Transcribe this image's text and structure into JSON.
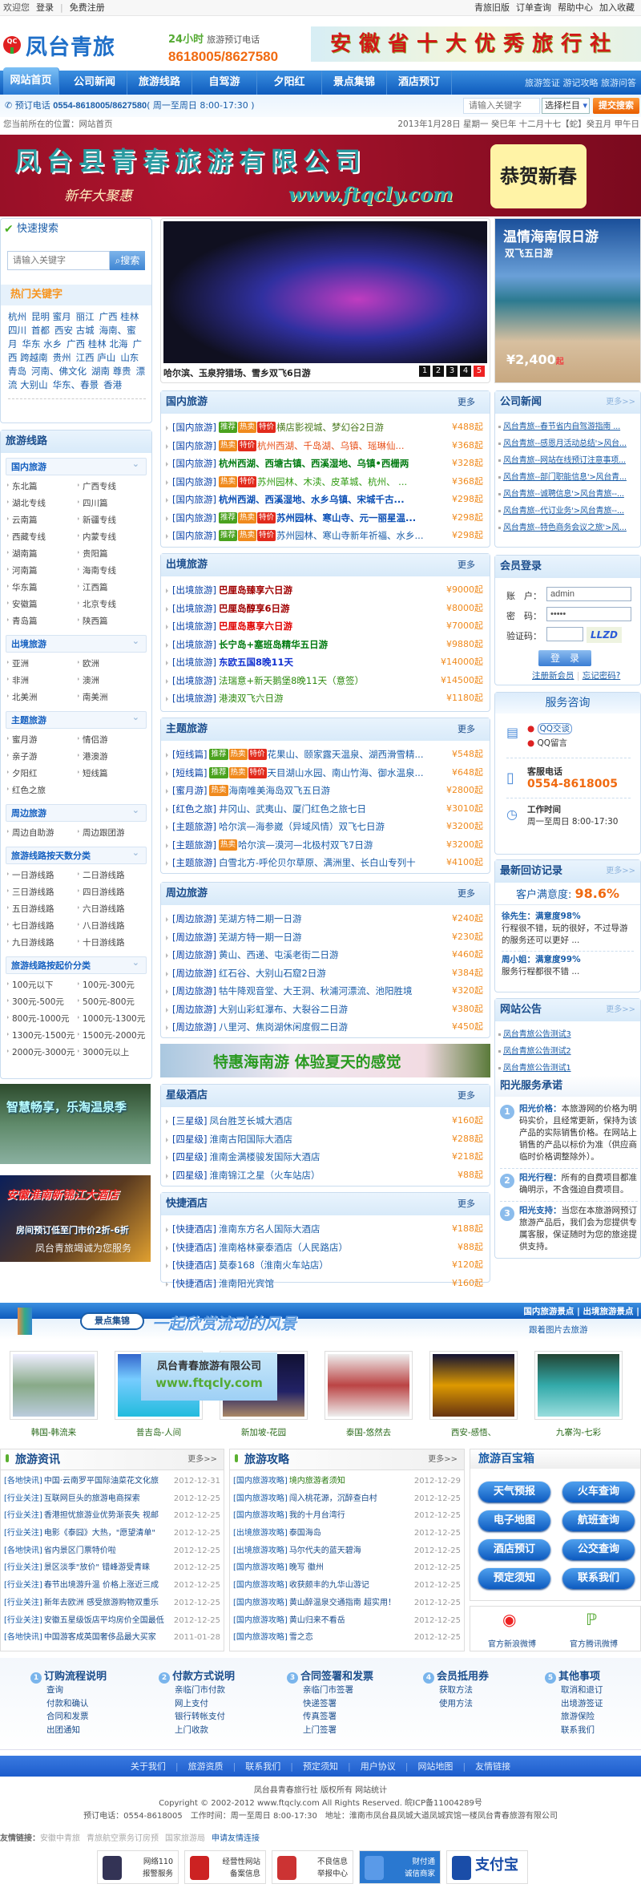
{
  "topbar": {
    "welcome": "欢迎您",
    "login": "登录",
    "register": "免费注册",
    "links": [
      "青旅旧版",
      "订单查询",
      "帮助中心",
      "加入收藏"
    ]
  },
  "header": {
    "logo_text": "凤台青旅",
    "logo_badge": "QC",
    "hotline_24": "24小时",
    "hotline_label": "旅游预订电话",
    "hotline": "8618005/8627580",
    "banner": "安徽省十大优秀旅行社"
  },
  "nav": {
    "items": [
      "网站首页",
      "公司新闻",
      "旅游线路",
      "自驾游",
      "夕阳红",
      "景点集锦",
      "酒店预订"
    ],
    "extra": [
      "旅游签证",
      "游记攻略",
      "旅游问答"
    ]
  },
  "subbar": {
    "phone_label": "预订电话",
    "phone": "0554-8618005/8627580",
    "hours": "( 周一至周日 8:00-17:30 )",
    "search_placeholder": "请输入关键字",
    "select_value": "选择栏目",
    "search_button": "提交搜索"
  },
  "breadcrumb": {
    "label": "您当前所在的位置：",
    "current": "网站首页",
    "date": "2013年1月28日 星期一 癸巳年 十二月十七【蛇】癸丑月 甲午日"
  },
  "main_banner": {
    "company": "凤台县青春旅游有限公司",
    "promo": "新年大聚惠",
    "url": "www.ftqcly.com",
    "greeting": "恭贺新春"
  },
  "quick_search": {
    "title": "快速搜索",
    "placeholder": "请输入关键字",
    "button": "搜索",
    "hot_title": "热门关键字",
    "keywords": [
      "杭州",
      "昆明 蜜月",
      "丽江",
      "广西 桂林",
      "四川",
      "首都",
      "西安 古城",
      "海南、蜜月",
      "华东 水乡",
      "广西 桂林 北海",
      "广西 跨越南",
      "贵州",
      "江西 庐山",
      "山东 青岛",
      "河南、佛文化",
      "湖南 尊贵",
      "漂流 大别山",
      "华东、春景",
      "香港"
    ]
  },
  "routes": {
    "title": "旅游线路",
    "groups": [
      {
        "name": "国内旅游",
        "items": [
          "东北篇",
          "广西专线",
          "湖北专线",
          "四川篇",
          "云南篇",
          "新疆专线",
          "西藏专线",
          "内蒙专线",
          "湖南篇",
          "贵阳篇",
          "河南篇",
          "海南专线",
          "华东篇",
          "江西篇",
          "安徽篇",
          "北京专线",
          "青岛篇",
          "陕西篇"
        ]
      },
      {
        "name": "出境旅游",
        "items": [
          "亚洲",
          "欧洲",
          "非洲",
          "澳洲",
          "北美洲",
          "南美洲"
        ]
      },
      {
        "name": "主题旅游",
        "items": [
          "蜜月游",
          "情侣游",
          "亲子游",
          "港澳游",
          "夕阳红",
          "短线篇",
          "红色之旅"
        ]
      },
      {
        "name": "周边旅游",
        "items": [
          "周边自助游",
          "周边跟团游"
        ]
      },
      {
        "name": "旅游线路按天数分类",
        "items": [
          "一日游线路",
          "二日游线路",
          "三日游线路",
          "四日游线路",
          "五日游线路",
          "六日游线路",
          "七日游线路",
          "八日游线路",
          "九日游线路",
          "十日游线路"
        ]
      },
      {
        "name": "旅游线路按起价分类",
        "items": [
          "100元以下",
          "100元-300元",
          "300元-500元",
          "500元-800元",
          "800元-1000元",
          "1000元-1300元",
          "1300元-1500元",
          "1500元-2000元",
          "2000元-3000元",
          "3000元以上"
        ]
      }
    ]
  },
  "left_ads": [
    {
      "text": "智慧畅享，乐淘温泉季"
    },
    {
      "text": "安徽淮南新锦江大酒店",
      "sub": "房间预订低至门市价2折-6折",
      "foot": "凤台青旅竭诚为您服务"
    }
  ],
  "slideshow": {
    "caption": "哈尔滨、玉泉狩猎场、雪乡双飞6日游",
    "pages": [
      "1",
      "2",
      "3",
      "4",
      "5"
    ],
    "active": "5"
  },
  "promo": {
    "title": "温情海南假日游",
    "sub": "双飞五日游",
    "price": "¥2,400",
    "price_suffix": "起"
  },
  "tags": [
    "推荐",
    "热卖",
    "特价"
  ],
  "sections": [
    {
      "title": "国内旅游",
      "more": "更多",
      "rows": [
        {
          "cat": "[国内旅游]",
          "tags": [
            0,
            1,
            2
          ],
          "title": "横店影视城、梦幻谷2日游",
          "color": "#4a7a1e",
          "bold": false,
          "price": "¥488起"
        },
        {
          "cat": "[国内旅游]",
          "tags": [
            1,
            2
          ],
          "title": "杭州西湖、千岛湖、乌镇、瑶琳仙...",
          "color": "#e8501a",
          "bold": false,
          "price": "¥368起"
        },
        {
          "cat": "[国内旅游]",
          "tags": [],
          "title": "杭州西湖、西塘古镇、西溪湿地、乌镇•西栅两",
          "color": "#007a10",
          "bold": true,
          "price": "¥328起"
        },
        {
          "cat": "[国内旅游]",
          "tags": [
            1,
            2
          ],
          "title": "苏州园林、木渎、皮革城、杭州、 ...",
          "color": "#2f9a10",
          "bold": false,
          "price": "¥368起"
        },
        {
          "cat": "[国内旅游]",
          "tags": [],
          "title": "杭州西湖、西溪湿地、水乡乌镇、宋城千古...",
          "color": "#0b4fb5",
          "bold": true,
          "price": "¥298起"
        },
        {
          "cat": "[国内旅游]",
          "tags": [
            0,
            1,
            2
          ],
          "title": "苏州园林、寒山寺、元一丽星温...",
          "color": "#0b4fb5",
          "bold": true,
          "price": "¥298起"
        },
        {
          "cat": "[国内旅游]",
          "tags": [
            0,
            1,
            2
          ],
          "title": "苏州园林、寒山寺新年祈福、水乡...",
          "color": "#1a5da8",
          "bold": false,
          "price": "¥298起"
        }
      ]
    },
    {
      "title": "出境旅游",
      "more": "更多",
      "rows": [
        {
          "cat": "[出境旅游]",
          "tags": [],
          "title": "巴厘岛臻享六日游",
          "color": "#a00000",
          "bold": true,
          "price": "¥9000起"
        },
        {
          "cat": "[出境旅游]",
          "tags": [],
          "title": "巴厘岛醇享6日游",
          "color": "#a00000",
          "bold": true,
          "price": "¥8000起"
        },
        {
          "cat": "[出境旅游]",
          "tags": [],
          "title": "巴厘岛惠享六日游",
          "color": "#e00000",
          "bold": true,
          "price": "¥7000起"
        },
        {
          "cat": "[出境旅游]",
          "tags": [],
          "title": "长宁岛+塞班岛精华五日游",
          "color": "#007a10",
          "bold": true,
          "price": "¥9880起"
        },
        {
          "cat": "[出境旅游]",
          "tags": [],
          "title": "东欧五国8晚11天",
          "color": "#1030d0",
          "bold": true,
          "price": "¥14000起"
        },
        {
          "cat": "[出境旅游]",
          "tags": [],
          "title": "法瑞意+新天鹅堡8晚11天（意签）",
          "color": "#2f8a10",
          "bold": false,
          "price": "¥14500起"
        },
        {
          "cat": "[出境旅游]",
          "tags": [],
          "title": "港澳双飞六日游",
          "color": "#2f8a10",
          "bold": false,
          "price": "¥1180起"
        }
      ]
    },
    {
      "title": "主题旅游",
      "more": "更多",
      "rows": [
        {
          "cat": "[短线篇]",
          "tags": [
            0,
            1,
            2
          ],
          "title": "花果山、颐家露天温泉、湖西滑雪精...",
          "color": "#1a5da8",
          "bold": false,
          "price": "¥548起"
        },
        {
          "cat": "[短线篇]",
          "tags": [
            0,
            1,
            2
          ],
          "title": "天目湖山水园、南山竹海、御水温泉...",
          "color": "#1a5da8",
          "bold": false,
          "price": "¥648起"
        },
        {
          "cat": "[蜜月游]",
          "tags": [
            1
          ],
          "title": "海南唯美海岛双飞五日游",
          "color": "#1a5da8",
          "bold": false,
          "price": "¥2800起"
        },
        {
          "cat": "[红色之旅]",
          "tags": [],
          "title": "井冈山、武夷山、厦门红色之旅七日",
          "color": "#1a5da8",
          "bold": false,
          "price": "¥3010起"
        },
        {
          "cat": "[主题旅游]",
          "tags": [],
          "title": "哈尔滨—海参崴（异域风情）双飞七日游",
          "color": "#1a5da8",
          "bold": false,
          "price": "¥3200起"
        },
        {
          "cat": "[主题旅游]",
          "tags": [
            1
          ],
          "title": "哈尔滨—漠河—北极村双飞7日游",
          "color": "#1a5da8",
          "bold": false,
          "price": "¥3200起"
        },
        {
          "cat": "[主题旅游]",
          "tags": [],
          "title": "白雪北方-呼伦贝尔草原、满洲里、长白山专列十",
          "color": "#1a5da8",
          "bold": false,
          "price": "¥4100起"
        }
      ]
    },
    {
      "title": "周边旅游",
      "more": "更多",
      "rows": [
        {
          "cat": "[周边旅游]",
          "tags": [],
          "title": "芜湖方特二期一日游",
          "color": "#1a5da8",
          "bold": false,
          "price": "¥240起"
        },
        {
          "cat": "[周边旅游]",
          "tags": [],
          "title": "芜湖方特一期一日游",
          "color": "#1a5da8",
          "bold": false,
          "price": "¥230起"
        },
        {
          "cat": "[周边旅游]",
          "tags": [],
          "title": "黄山、西递、屯溪老街二日游",
          "color": "#1a5da8",
          "bold": false,
          "price": "¥460起"
        },
        {
          "cat": "[周边旅游]",
          "tags": [],
          "title": "红石谷、大别山石窟2日游",
          "color": "#1a5da8",
          "bold": false,
          "price": "¥384起"
        },
        {
          "cat": "[周边旅游]",
          "tags": [],
          "title": "牯牛降观音堂、大王洞、秋浦河漂流、池阳胜境",
          "color": "#1a5da8",
          "bold": false,
          "price": "¥320起"
        },
        {
          "cat": "[周边旅游]",
          "tags": [],
          "title": "大别山彩虹瀑布、大裂谷二日游",
          "color": "#1a5da8",
          "bold": false,
          "price": "¥380起"
        },
        {
          "cat": "[周边旅游]",
          "tags": [],
          "title": "八里河、焦岗湖休闲度假二日游",
          "color": "#1a5da8",
          "bold": false,
          "price": "¥450起"
        }
      ]
    },
    {
      "title": "星级酒店",
      "more": "更多",
      "rows": [
        {
          "cat": "[三星级]",
          "tags": [],
          "title": "凤台胜芝长城大酒店",
          "color": "#1a5da8",
          "bold": false,
          "price": "¥160起"
        },
        {
          "cat": "[四星级]",
          "tags": [],
          "title": "淮南古阳国际大酒店",
          "color": "#1a5da8",
          "bold": false,
          "price": "¥288起"
        },
        {
          "cat": "[四星级]",
          "tags": [],
          "title": "淮南金满楼骏发国际大酒店",
          "color": "#1a5da8",
          "bold": false,
          "price": "¥218起"
        },
        {
          "cat": "[四星级]",
          "tags": [],
          "title": "淮南锦江之星（火车站店）",
          "color": "#1a5da8",
          "bold": false,
          "price": "¥88起"
        }
      ]
    },
    {
      "title": "快捷酒店",
      "more": "更多",
      "rows": [
        {
          "cat": "[快捷酒店]",
          "tags": [],
          "title": "淮南东方名人国际大酒店",
          "color": "#1a5da8",
          "bold": false,
          "price": "¥188起"
        },
        {
          "cat": "[快捷酒店]",
          "tags": [],
          "title": "淮南格林豪泰酒店（人民路店）",
          "color": "#1a5da8",
          "bold": false,
          "price": "¥88起"
        },
        {
          "cat": "[快捷酒店]",
          "tags": [],
          "title": "莫泰168（淮南火车站店）",
          "color": "#1a5da8",
          "bold": false,
          "price": "¥120起"
        },
        {
          "cat": "[快捷酒店]",
          "tags": [],
          "title": "淮南阳光宾馆",
          "color": "#1a5da8",
          "bold": false,
          "price": "¥160起"
        }
      ]
    }
  ],
  "hainan_banner": "特惠海南游 体验夏天的感觉",
  "company_news": {
    "title": "公司新闻",
    "more": "更多>>",
    "items": [
      "风台青旅--春节省内自驾游指南 ...",
      "风台青旅--感恩月活动总结'>风台...",
      "风台青旅--网站在线预订注意事项...",
      "风台青旅--部门职能信息'>风台青...",
      "风台青旅--诚聘信息'>风台青旅--...",
      "风台青旅--代订业务'>风台青旅--...",
      "风台青旅--特色商务会议之旅'>风..."
    ]
  },
  "login": {
    "title": "会员登录",
    "account_label": "账　户：",
    "account_value": "admin",
    "password_label": "密　码：",
    "password_value": "•••••",
    "captcha_label": "验证码：",
    "captcha_text": "LLZD",
    "submit": "登　录",
    "register": "注册新会员",
    "forgot": "忘记密码?"
  },
  "service": {
    "title": "服务咨询",
    "qq_chat": "QQ交谈",
    "qq_msg": "QQ留言",
    "phone_label": "客服电话",
    "phone": "0554-8618005",
    "hours_label": "工作时间",
    "hours": "周一至周日 8:00-17:30"
  },
  "feedback": {
    "title": "最新回访记录",
    "more": "更多>>",
    "satisfaction_label": "客户满意度:",
    "satisfaction": "98.6%",
    "items": [
      {
        "name": "徐先生：满意度98%",
        "text": "行程很不错，玩的很好，不过导游的服务还可以更好 ..."
      },
      {
        "name": "周小姐：满意度99%",
        "text": "服务行程都很不错 ..."
      }
    ]
  },
  "notices": {
    "title": "网站公告",
    "more": "更多>>",
    "items": [
      "凤台青旅公告测试3",
      "凤台青旅公告测试2",
      "凤台青旅公告测试1"
    ]
  },
  "promise": {
    "title": "阳光服务承诺",
    "items": [
      {
        "head": "阳光价格：",
        "text": "本旅游网的价格为明码实价，且经常更新，保持为该产品的实际销售价格。在网站上销售的产品以标价为准（供应商临时价格调整除外）。"
      },
      {
        "head": "阳光行程：",
        "text": "所有的自费项目都准确明示，不含强迫自费项目。"
      },
      {
        "head": "阳光支持：",
        "text": "当您在本旅游网预订旅游产品后，我们会为您提供专属客服，保证随时为您的旅途提供支持。"
      }
    ]
  },
  "scenic": {
    "tab": "景点集锦",
    "slogan": "一起欣赏流动的风景",
    "links": "国内旅游景点 | 出境旅游景点 |",
    "sub": "跟着图片去旅游",
    "overlay_company": "凤台青春旅游有限公司",
    "overlay_url": "www.ftqcly.com",
    "photos": [
      "韩国-韩流来",
      "普吉岛-人间",
      "新加坡-花园",
      "泰国-悠然去",
      "西安-感悟、",
      "九寨沟-七彩"
    ]
  },
  "news": {
    "title": "旅游资讯",
    "more": "更多>>",
    "items": [
      {
        "cat": "[各地快讯]",
        "title": "中国·云南罗平国际油菜花文化旅",
        "date": "2012-12-31"
      },
      {
        "cat": "[行业关注]",
        "title": "互联网巨头的旅游电商探索",
        "date": "2012-12-25"
      },
      {
        "cat": "[行业关注]",
        "title": "香港担忧旅游业优势渐丧失 视邮",
        "date": "2012-12-25"
      },
      {
        "cat": "[行业关注]",
        "title": "电影《泰囧》大热，\"愿望清单\"",
        "date": "2012-12-25"
      },
      {
        "cat": "[各地快讯]",
        "title": "省内景区门票特价啦",
        "date": "2012-12-25"
      },
      {
        "cat": "[行业关注]",
        "title": "景区淡季\"放价\" 错峰游受青睐",
        "date": "2012-12-25"
      },
      {
        "cat": "[行业关注]",
        "title": "春节出境游升温 价格上涨近三成",
        "date": "2012-12-25"
      },
      {
        "cat": "[行业关注]",
        "title": "新年去欧洲 感受旅游购物双重乐",
        "date": "2012-12-25"
      },
      {
        "cat": "[行业关注]",
        "title": "安徽五星级饭店平均房价全国最低",
        "date": "2012-12-25"
      },
      {
        "cat": "[各地快讯]",
        "title": "中国游客成英国奢侈品最大买家",
        "date": "2011-01-28"
      }
    ]
  },
  "guides": {
    "title": "旅游攻略",
    "more": "更多>>",
    "items": [
      {
        "cat": "[国内旅游攻略]",
        "title": "境内旅游者须知",
        "date": "2012-12-29"
      },
      {
        "cat": "[国内旅游攻略]",
        "title": "闯入桃花源，沉醉查白村",
        "date": "2012-12-25"
      },
      {
        "cat": "[国内旅游攻略]",
        "title": "我的十月台湾行",
        "date": "2012-12-25"
      },
      {
        "cat": "[出境旅游攻略]",
        "title": "泰国海岛",
        "date": "2012-12-25"
      },
      {
        "cat": "[出境旅游攻略]",
        "title": "马尔代夫的蓝天碧海",
        "date": "2012-12-25"
      },
      {
        "cat": "[国内旅游攻略]",
        "title": "晚写 徽州",
        "date": "2012-12-25"
      },
      {
        "cat": "[国内旅游攻略]",
        "title": "收获颇丰的九华山游记",
        "date": "2012-12-25"
      },
      {
        "cat": "[国内旅游攻略]",
        "title": "黄山醉温泉交通指南 超实用！",
        "date": "2012-12-25"
      },
      {
        "cat": "[国内旅游攻略]",
        "title": "黄山归来不看岳",
        "date": "2012-12-25"
      },
      {
        "cat": "[国内旅游攻略]",
        "title": "雪之恋",
        "date": "2012-12-25"
      }
    ]
  },
  "toolbox": {
    "title": "旅游百宝箱",
    "buttons": [
      "天气预报",
      "火车查询",
      "电子地图",
      "航班查询",
      "酒店预订",
      "公交查询",
      "预定须知",
      "联系我们"
    ],
    "weibo_sina": "官方新浪微博",
    "weibo_qq": "官方腾讯微博"
  },
  "help": [
    {
      "num": "1",
      "title": "订购流程说明",
      "items": [
        "查询",
        "付款和确认",
        "合同和发票",
        "出团通知"
      ]
    },
    {
      "num": "2",
      "title": "付款方式说明",
      "items": [
        "亲临门市付款",
        "网上支付",
        "银行转帐支付",
        "上门收款"
      ]
    },
    {
      "num": "3",
      "title": "合同签署和发票",
      "items": [
        "亲临门市签署",
        "快递签署",
        "传真签署",
        "上门签署"
      ]
    },
    {
      "num": "4",
      "title": "会员抵用券",
      "items": [
        "获取方法",
        "使用方法"
      ]
    },
    {
      "num": "5",
      "title": "其他事项",
      "items": [
        "取消和退订",
        "出境游签证",
        "旅游保险",
        "联系我们"
      ]
    }
  ],
  "footer": {
    "links": [
      "关于我们",
      "旅游资质",
      "联系我们",
      "预定须知",
      "用户协议",
      "网站地图",
      "友情链接"
    ],
    "line1": "凤台县青春旅行社 版权所有 网站统计",
    "line2": "Copyright © 2002-2012 www.ftqcly.com All Rights Reserved. 皖ICP备11004289号",
    "line3": "预订电话：0554-8618005　工作时间：周一至周日 8:00-17:30　地址：淮南市凤台县凤城大道凤城宾馆一楼凤台青春旅游有限公司",
    "friend_label": "友情链接：",
    "friends": [
      "安徽中青旅",
      "青旅航空票务订房预",
      "国家旅游局"
    ],
    "apply": "申请友情连接",
    "badges": [
      {
        "l1": "网络110",
        "l2": "报警服务"
      },
      {
        "l1": "经营性网站",
        "l2": "备案信息"
      },
      {
        "l1": "不良信息",
        "l2": "举报中心"
      },
      {
        "l1": "财付通",
        "l2": "诚信商家"
      },
      {
        "l1": "支付宝",
        "l2": ""
      }
    ]
  },
  "colors": {
    "brand_blue": "#1560c0",
    "price_orange": "#f08a1d",
    "accent_orange": "#f06a10"
  }
}
